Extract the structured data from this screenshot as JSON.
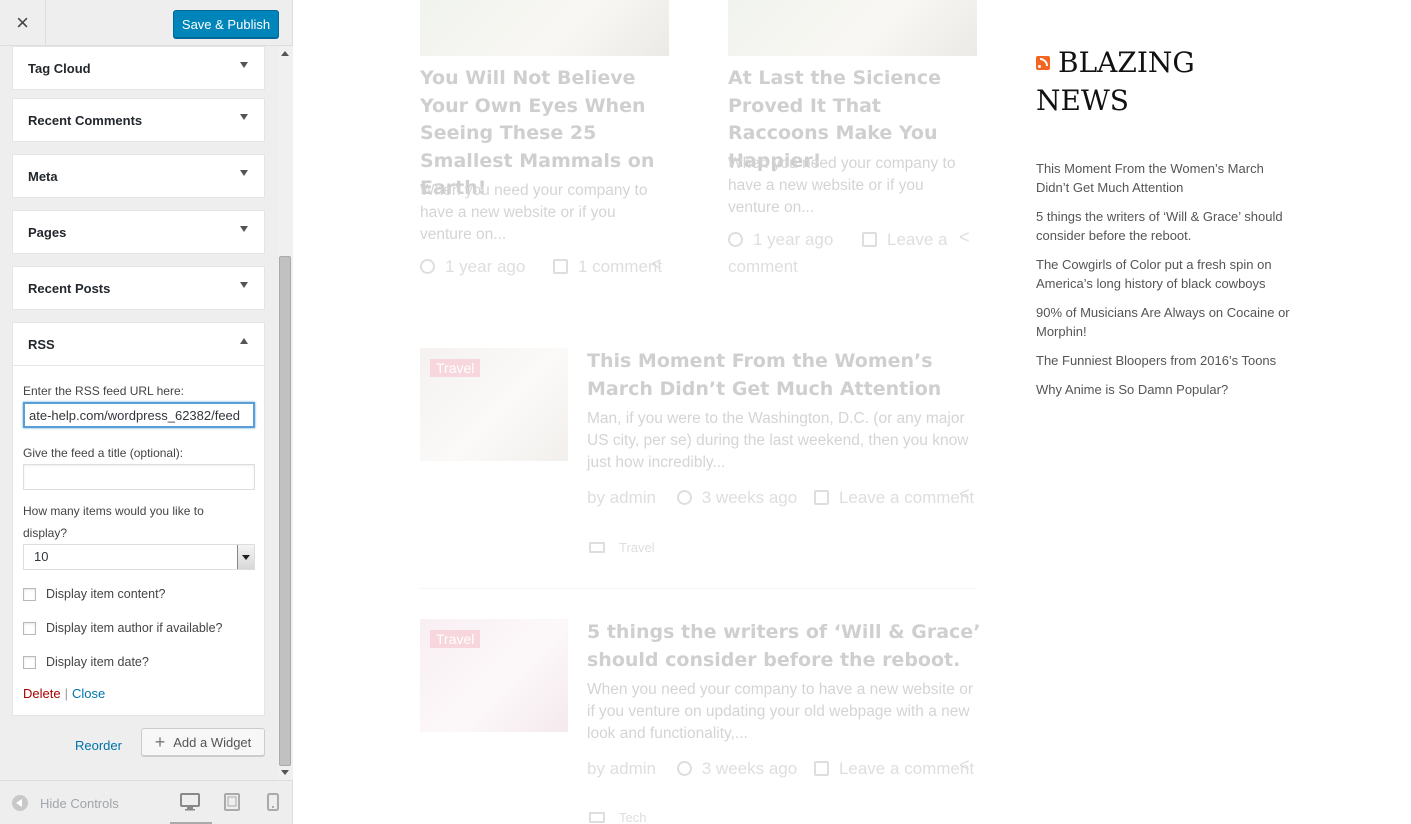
{
  "header": {
    "close_symbol": "×",
    "publish_label": "Save & Publish"
  },
  "widgets": {
    "tag_cloud": "Tag Cloud",
    "recent_comments": "Recent Comments",
    "meta": "Meta",
    "pages": "Pages",
    "recent_posts": "Recent Posts",
    "rss": "RSS"
  },
  "rss_form": {
    "url_label": "Enter the RSS feed URL here:",
    "url_value": "ate-help.com/wordpress_62382/feed",
    "title_label": "Give the feed a title (optional):",
    "title_value": "",
    "items_label": "How many items would you like to display?",
    "items_value": "10",
    "opt_content": "Display item content?",
    "opt_author": "Display item author if available?",
    "opt_date": "Display item date?",
    "delete_label": "Delete",
    "separator": "|",
    "close_label": "Close"
  },
  "widget_actions": {
    "reorder": "Reorder",
    "add_widget": "Add a Widget",
    "plus": "+"
  },
  "footer": {
    "hide_controls": "Hide Controls"
  },
  "preview": {
    "post1": {
      "title": "You Will Not Believe Your Own Eyes When Seeing These 25 Smallest Mammals on Earth!",
      "excerpt": "When you need your company to have a new website or if you venture on...",
      "time": "1 year ago",
      "comments": "1 comment"
    },
    "post2": {
      "title": "At Last the Sicience Proved It That Raccoons Make You Happier!",
      "excerpt": "When you need your company to have a new website or if you venture on...",
      "time": "1 year ago",
      "comments": "Leave a comment"
    },
    "post3": {
      "badge": "Travel",
      "title": "This Moment From the Women’s March Didn’t Get Much Attention",
      "excerpt": "Man, if you were to the Washington, D.C. (or any major US city, per se) during the last weekend, then you know just how incredibly...",
      "by": "by",
      "author": "admin",
      "time": "3 weeks ago",
      "comments": "Leave a comment",
      "category": "Travel"
    },
    "post4": {
      "badge": "Travel",
      "title": "5 things the writers of ‘Will & Grace’ should consider before the reboot.",
      "excerpt": "When you need your company to have a new website or if you venture on updating your old webpage with a new look and functionality,...",
      "by": "by",
      "author": "admin",
      "time": "3 weeks ago",
      "comments": "Leave a comment",
      "category": "Tech"
    },
    "share_symbol": "<",
    "rss_widget": {
      "title": "BLAZING NEWS",
      "items": [
        "This Moment From the Women’s March Didn’t Get Much Attention",
        "5 things the writers of ‘Will & Grace’ should consider before the reboot.",
        "The Cowgirls of Color put a fresh spin on America’s long history of black cowboys",
        "90% of Musicians Are Always on Cocaine or Morphin!",
        "The Funniest Bloopers from 2016’s Toons",
        "Why Anime is So Damn Popular?"
      ]
    }
  },
  "colors": {
    "primary": "#0085ba",
    "link": "#0073aa",
    "delete": "#a00000",
    "rss_orange": "#f26522",
    "badge": "#e26d8a"
  }
}
